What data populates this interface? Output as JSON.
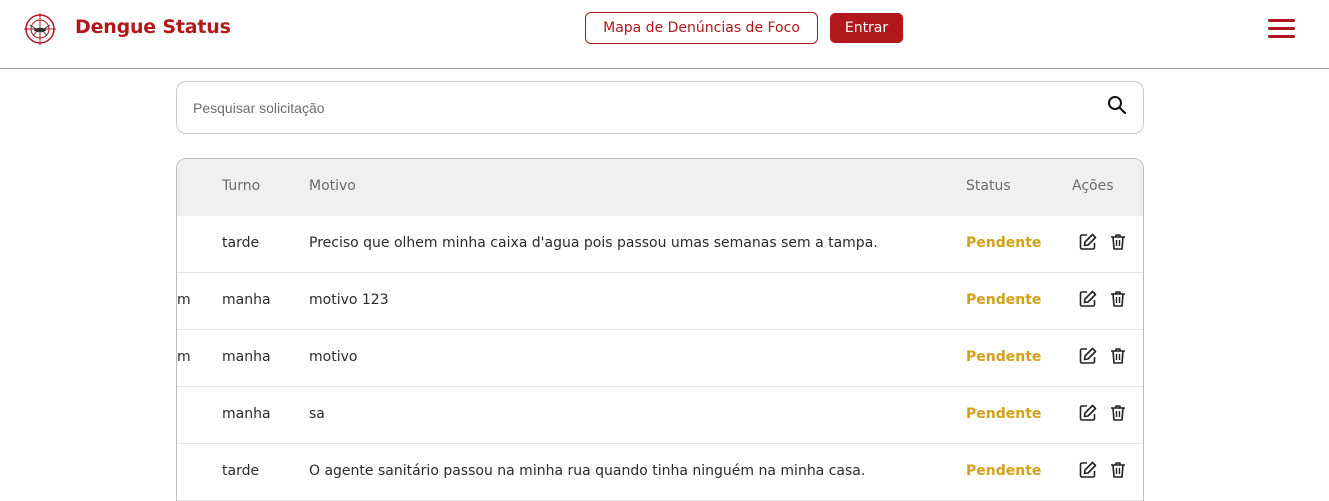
{
  "header": {
    "brand": "Dengue Status",
    "map_button": "Mapa de Denúncias de Foco",
    "login_button": "Entrar"
  },
  "search": {
    "placeholder": "Pesquisar solicitação",
    "value": ""
  },
  "table": {
    "columns": {
      "partial": "",
      "turno": "Turno",
      "motivo": "Motivo",
      "status": "Status",
      "acoes": "Ações"
    },
    "rows": [
      {
        "partial": "",
        "turno": "tarde",
        "motivo": "Preciso que olhem minha caixa d'agua pois passou umas semanas sem a tampa.",
        "status": "Pendente"
      },
      {
        "partial": "m",
        "turno": "manha",
        "motivo": "motivo 123",
        "status": "Pendente"
      },
      {
        "partial": "m",
        "turno": "manha",
        "motivo": "motivo",
        "status": "Pendente"
      },
      {
        "partial": "",
        "turno": "manha",
        "motivo": "sa",
        "status": "Pendente"
      },
      {
        "partial": "",
        "turno": "tarde",
        "motivo": "O agente sanitário passou na minha rua quando tinha ninguém na minha casa.",
        "status": "Pendente"
      }
    ]
  },
  "icons": {
    "logo": "mosquito-target-logo",
    "menu": "hamburger-menu-icon",
    "search": "search-icon",
    "edit": "edit-icon",
    "delete": "trash-icon"
  },
  "colors": {
    "brand": "#b0181c",
    "status_pending": "#d4a017",
    "header_row": "#f0f0f0"
  }
}
